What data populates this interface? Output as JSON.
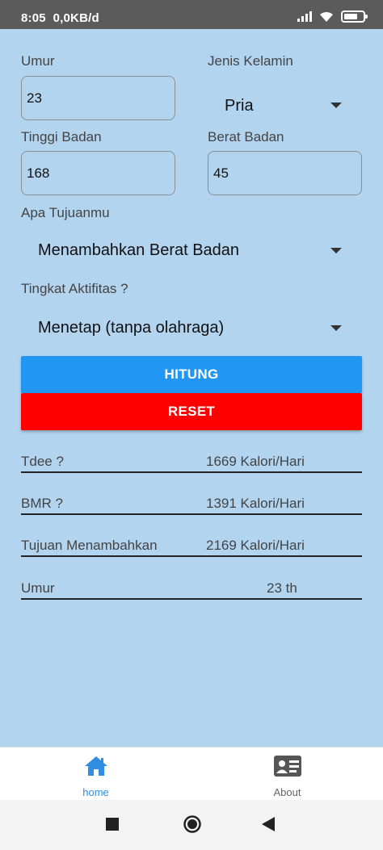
{
  "status_bar": {
    "time": "8:05",
    "speed": "0,0KB/d"
  },
  "form": {
    "age_label": "Umur",
    "age_value": "23",
    "gender_label": "Jenis Kelamin",
    "gender_value": "Pria",
    "height_label": "Tinggi Badan",
    "height_value": "168",
    "weight_label": "Berat Badan",
    "weight_value": "45",
    "goal_label": "Apa Tujuanmu",
    "goal_value": "Menambahkan Berat Badan",
    "activity_label": "Tingkat Aktifitas ?",
    "activity_value": "Menetap (tanpa olahraga)"
  },
  "buttons": {
    "calculate": "HITUNG",
    "reset": "RESET"
  },
  "results": [
    {
      "label": "Tdee ?",
      "value": "1669 Kalori/Hari"
    },
    {
      "label": "BMR ?",
      "value": "1391 Kalori/Hari"
    },
    {
      "label": "Tujuan Menambahkan",
      "value": "2169 Kalori/Hari"
    },
    {
      "label": "Umur",
      "value": "23 th"
    }
  ],
  "bottom_nav": {
    "home": {
      "label": "home",
      "icon": "home-icon"
    },
    "about": {
      "label": "About",
      "icon": "contact-card-icon"
    }
  },
  "colors": {
    "background": "#b3d4ef",
    "calculate_button": "#2196f3",
    "reset_button": "#ff0000",
    "nav_active": "#2f8de4"
  }
}
